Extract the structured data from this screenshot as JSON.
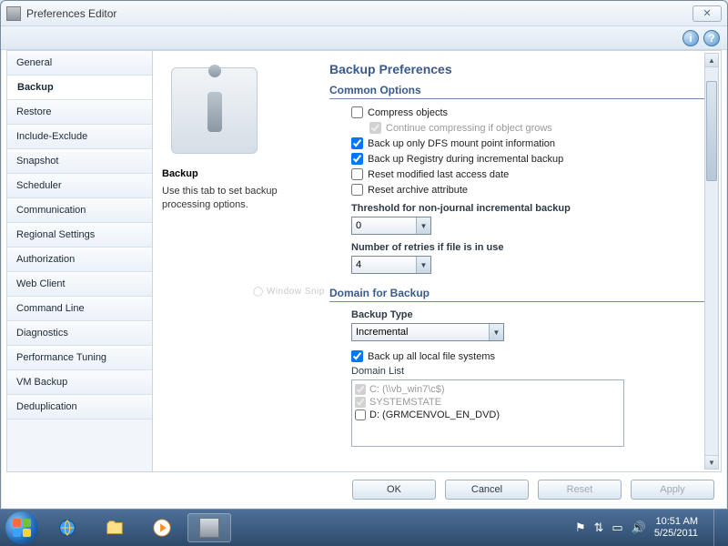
{
  "window": {
    "title": "Preferences Editor",
    "close_glyph": "✕"
  },
  "header": {
    "info_glyph": "i",
    "help_glyph": "?"
  },
  "sidebar": {
    "items": [
      {
        "label": "General"
      },
      {
        "label": "Backup"
      },
      {
        "label": "Restore"
      },
      {
        "label": "Include-Exclude"
      },
      {
        "label": "Snapshot"
      },
      {
        "label": "Scheduler"
      },
      {
        "label": "Communication"
      },
      {
        "label": "Regional Settings"
      },
      {
        "label": "Authorization"
      },
      {
        "label": "Web Client"
      },
      {
        "label": "Command Line"
      },
      {
        "label": "Diagnostics"
      },
      {
        "label": "Performance Tuning"
      },
      {
        "label": "VM Backup"
      },
      {
        "label": "Deduplication"
      }
    ],
    "selected_index": 1
  },
  "desc": {
    "heading": "Backup",
    "text": "Use this tab to set backup processing options."
  },
  "form": {
    "page_title": "Backup Preferences",
    "common": {
      "title": "Common Options",
      "compress": {
        "label": "Compress objects",
        "checked": false
      },
      "continue_compressing": {
        "label": "Continue compressing if object grows",
        "checked": true,
        "disabled": true
      },
      "dfs": {
        "label": "Back up only DFS mount point information",
        "checked": true
      },
      "registry": {
        "label": "Back up Registry during incremental backup",
        "checked": true
      },
      "reset_modified": {
        "label": "Reset modified last access date",
        "checked": false
      },
      "reset_archive": {
        "label": "Reset archive attribute",
        "checked": false
      },
      "threshold_label": "Threshold for non-journal incremental backup",
      "threshold_value": "0",
      "retries_label": "Number of retries if file is in use",
      "retries_value": "4"
    },
    "domain": {
      "title": "Domain for Backup",
      "backup_type_label": "Backup Type",
      "backup_type_value": "Incremental",
      "all_local": {
        "label": "Back up all local file systems",
        "checked": true
      },
      "domain_list_label": "Domain List",
      "items": [
        {
          "label": "C: (\\\\vb_win7\\c$)",
          "checked": true,
          "dim": true
        },
        {
          "label": "SYSTEMSTATE",
          "checked": true,
          "dim": true
        },
        {
          "label": "D: (GRMCENVOL_EN_DVD)",
          "checked": false,
          "dim": false
        }
      ]
    }
  },
  "buttons": {
    "ok": "OK",
    "cancel": "Cancel",
    "reset": "Reset",
    "apply": "Apply"
  },
  "ghost": "◯    Window Snip",
  "taskbar": {
    "time": "10:51 AM",
    "date": "5/25/2011"
  }
}
